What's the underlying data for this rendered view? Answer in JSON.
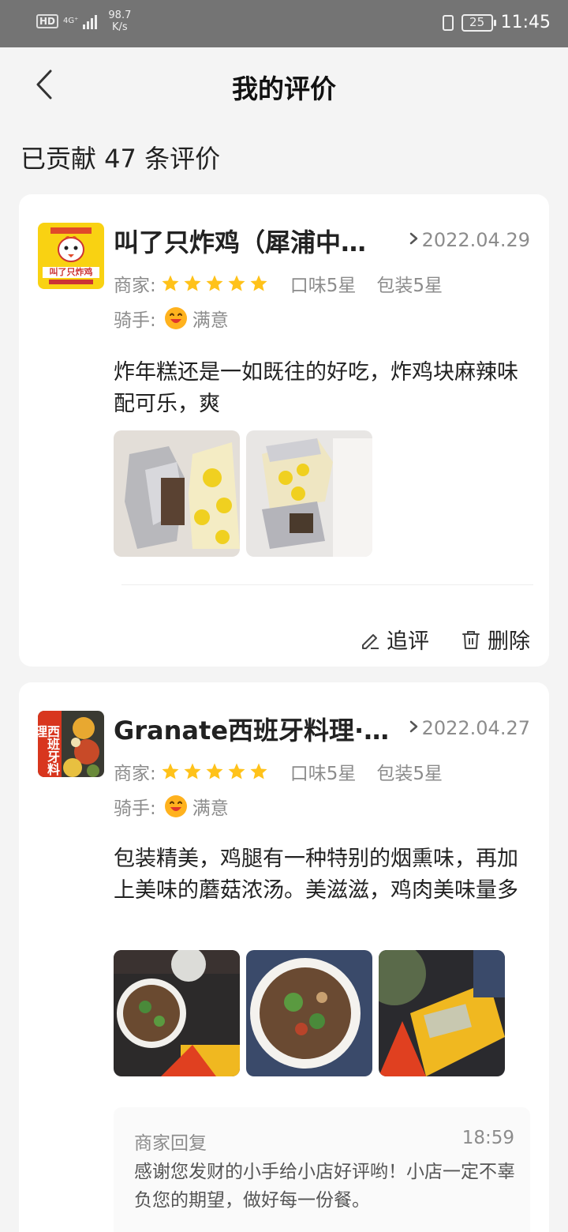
{
  "status_bar": {
    "hd": "HD",
    "network": "4G⁺",
    "speed_value": "98.7",
    "speed_unit": "K/s",
    "battery": "25",
    "time": "11:45"
  },
  "header": {
    "title": "我的评价"
  },
  "summary": {
    "text": "已贡献 47 条评价"
  },
  "labels": {
    "merchant": "商家:",
    "rider": "骑手:"
  },
  "reviews": [
    {
      "shop_name": "叫了只炸鸡（犀浦中…",
      "date": "2022.04.29",
      "merchant_stars": 5,
      "taste": "口味5星",
      "packaging": "包装5星",
      "rider_rating": "满意",
      "content": "炸年糕还是一如既往的好吃，炸鸡块麻辣味配可乐，爽",
      "logo_text": "叫了只炸鸡",
      "actions": {
        "follow_up": "追评",
        "delete": "删除"
      }
    },
    {
      "shop_name": "Granate西班牙料理·…",
      "date": "2022.04.27",
      "merchant_stars": 5,
      "taste": "口味5星",
      "packaging": "包装5星",
      "rider_rating": "满意",
      "content": "包装精美，鸡腿有一种特别的烟熏味，再加上美味的蘑菇浓汤。美滋滋，鸡肉美味量多",
      "logo_text": "西班牙料理",
      "reply": {
        "title": "商家回复",
        "time": "18:59",
        "text": "感谢您发财的小手给小店好评哟！小店一定不辜负您的期望，做好每一份餐。"
      }
    }
  ],
  "colors": {
    "star": "#ffc21a",
    "background": "#f4f4f4",
    "status_bar": "#747474",
    "meta_text": "#8c8c8c"
  }
}
